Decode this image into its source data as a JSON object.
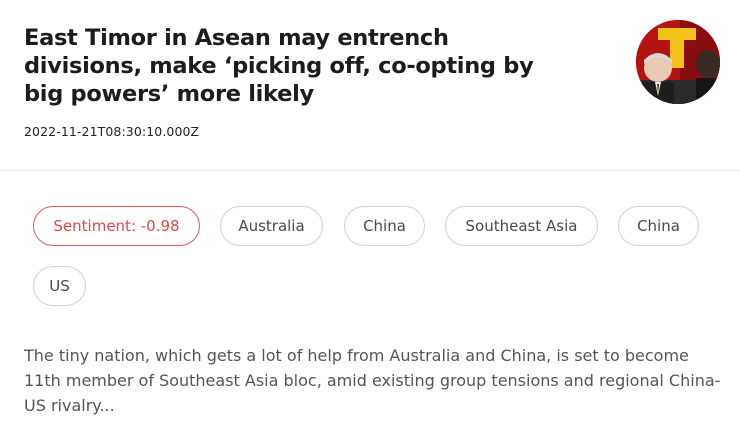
{
  "article": {
    "title": "East Timor in Asean may entrench divisions, make ‘picking off, co-opting by big powers’ more likely",
    "timestamp": "2022-11-21T08:30:10.000Z",
    "thumbnail_icon": "news-photo-thumbnail",
    "summary": "The tiny nation, which gets a lot of help from Australia and China, is set to become 11th member of Southeast Asia bloc, amid existing group tensions and regional China-US rivalry..."
  },
  "tags": {
    "sentiment": "Sentiment: -0.98",
    "items": [
      "Australia",
      "China",
      "Southeast Asia",
      "China",
      "US"
    ]
  },
  "colors": {
    "sentiment_accent": "#e04646",
    "tag_border": "#d3d3d3",
    "thumbnail_bg": "#c01414",
    "thumbnail_flag_yellow": "#f2c21b"
  }
}
